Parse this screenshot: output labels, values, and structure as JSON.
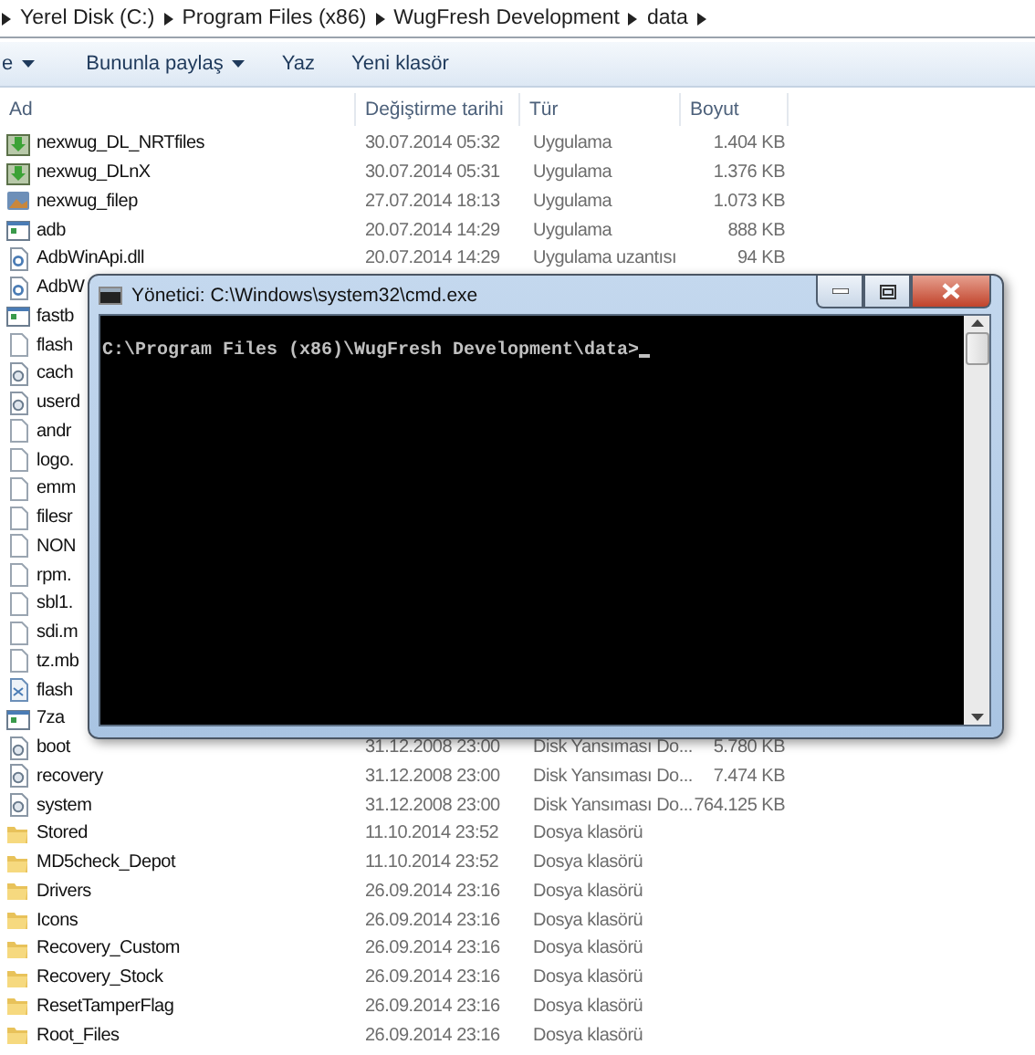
{
  "address_bar": {
    "segments": [
      "Yerel Disk (C:)",
      "Program Files (x86)",
      "WugFresh Development",
      "data"
    ]
  },
  "toolbar": {
    "items": [
      {
        "label": "e",
        "dropdown": true
      },
      {
        "label": "Bununla paylaş",
        "dropdown": true
      },
      {
        "label": "Yaz",
        "dropdown": false
      },
      {
        "label": "Yeni klasör",
        "dropdown": false
      }
    ]
  },
  "columns": [
    "Ad",
    "Değiştirme tarihi",
    "Tür",
    "Boyut"
  ],
  "files": [
    {
      "kind": "installer",
      "name": "nexwug_DL_NRTfiles",
      "date": "30.07.2014 05:32",
      "type": "Uygulama",
      "size": "1.404 KB"
    },
    {
      "kind": "installer",
      "name": "nexwug_DLnX",
      "date": "30.07.2014 05:31",
      "type": "Uygulama",
      "size": "1.376 KB"
    },
    {
      "kind": "app",
      "name": "nexwug_filep",
      "date": "27.07.2014 18:13",
      "type": "Uygulama",
      "size": "1.073 KB"
    },
    {
      "kind": "exe",
      "name": "adb",
      "date": "20.07.2014 14:29",
      "type": "Uygulama",
      "size": "888 KB"
    },
    {
      "kind": "dll",
      "name": "AdbWinApi.dll",
      "date": "20.07.2014 14:29",
      "type": "Uygulama uzantısı",
      "size": "94 KB"
    },
    {
      "kind": "dll",
      "name": "AdbW"
    },
    {
      "kind": "exe",
      "name": "fastb"
    },
    {
      "kind": "file",
      "name": "flash"
    },
    {
      "kind": "disk_image",
      "name": "cach"
    },
    {
      "kind": "disk_image",
      "name": "userd"
    },
    {
      "kind": "file",
      "name": "andr"
    },
    {
      "kind": "file",
      "name": "logo."
    },
    {
      "kind": "file",
      "name": "emm"
    },
    {
      "kind": "file",
      "name": "filesr"
    },
    {
      "kind": "file",
      "name": "NON"
    },
    {
      "kind": "file",
      "name": "rpm."
    },
    {
      "kind": "file",
      "name": "sbl1."
    },
    {
      "kind": "file",
      "name": "sdi.m"
    },
    {
      "kind": "file",
      "name": "tz.mb"
    },
    {
      "kind": "script",
      "name": "flash"
    },
    {
      "kind": "exe",
      "name": "7za"
    },
    {
      "kind": "disk_image",
      "name": "boot",
      "date": "31.12.2008 23:00",
      "type": "Disk Yansıması Do...",
      "size": "5.780 KB"
    },
    {
      "kind": "disk_image",
      "name": "recovery",
      "date": "31.12.2008 23:00",
      "type": "Disk Yansıması Do...",
      "size": "7.474 KB"
    },
    {
      "kind": "disk_image",
      "name": "system",
      "date": "31.12.2008 23:00",
      "type": "Disk Yansıması Do...",
      "size": "764.125 KB"
    },
    {
      "kind": "folder",
      "name": "Stored",
      "date": "11.10.2014 23:52",
      "type": "Dosya klasörü"
    },
    {
      "kind": "folder",
      "name": "MD5check_Depot",
      "date": "11.10.2014 23:52",
      "type": "Dosya klasörü"
    },
    {
      "kind": "folder",
      "name": "Drivers",
      "date": "26.09.2014 23:16",
      "type": "Dosya klasörü"
    },
    {
      "kind": "folder",
      "name": "Icons",
      "date": "26.09.2014 23:16",
      "type": "Dosya klasörü"
    },
    {
      "kind": "folder",
      "name": "Recovery_Custom",
      "date": "26.09.2014 23:16",
      "type": "Dosya klasörü"
    },
    {
      "kind": "folder",
      "name": "Recovery_Stock",
      "date": "26.09.2014 23:16",
      "type": "Dosya klasörü"
    },
    {
      "kind": "folder",
      "name": "ResetTamperFlag",
      "date": "26.09.2014 23:16",
      "type": "Dosya klasörü"
    },
    {
      "kind": "folder",
      "name": "Root_Files",
      "date": "26.09.2014 23:16",
      "type": "Dosya klasörü"
    }
  ],
  "console": {
    "title": "Yönetici: C:\\Windows\\system32\\cmd.exe",
    "lines": [
      "C:\\Program Files (x86)\\WugFresh Development\\data>"
    ],
    "cursor": true
  }
}
